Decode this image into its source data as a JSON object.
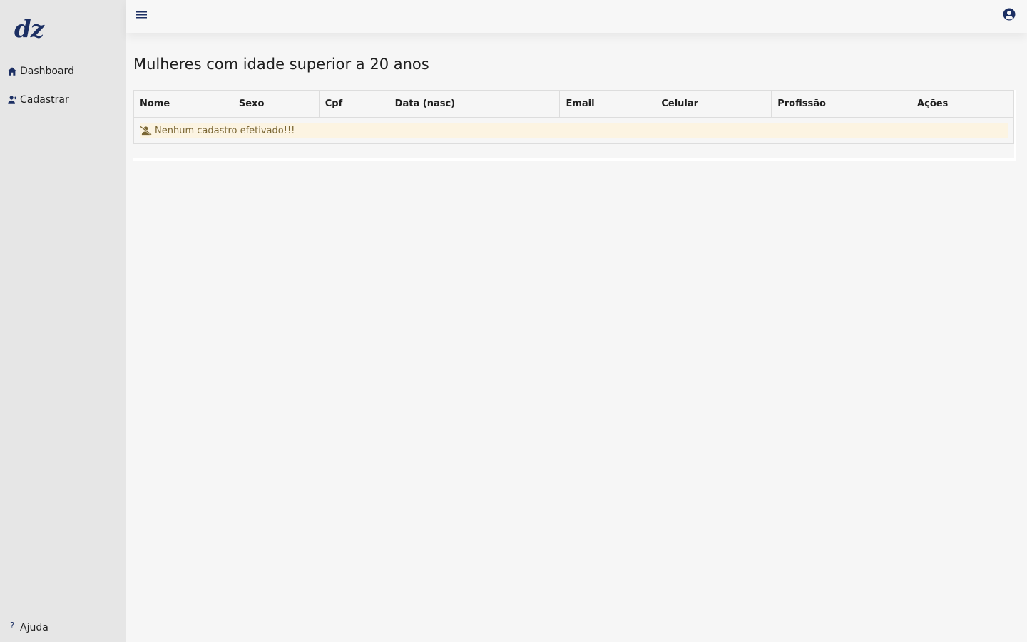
{
  "sidebar": {
    "logo": "dz",
    "items": [
      {
        "label": "Dashboard",
        "icon": "home-icon"
      },
      {
        "label": "Cadastrar",
        "icon": "user-plus-icon"
      }
    ],
    "help": {
      "label": "Ajuda",
      "glyph": "?",
      "icon": "question-icon"
    }
  },
  "topbar": {
    "menu_icon": "hamburger-menu-icon",
    "user_icon": "user-circle-icon"
  },
  "main": {
    "title": "Mulheres com idade superior a 20 anos",
    "table": {
      "columns": [
        "Nome",
        "Sexo",
        "Cpf",
        "Data (nasc)",
        "Email",
        "Celular",
        "Profissão",
        "Ações"
      ],
      "empty_message": "Nenhum cadastro efetivado!!!",
      "empty_icon": "user-slash-icon"
    }
  },
  "colors": {
    "accent": "#1c2f63",
    "sidebar_bg": "#e6e6e6",
    "page_bg": "#f6f6f6",
    "alert_bg": "#fcf4e2",
    "alert_text": "#7a6633"
  }
}
